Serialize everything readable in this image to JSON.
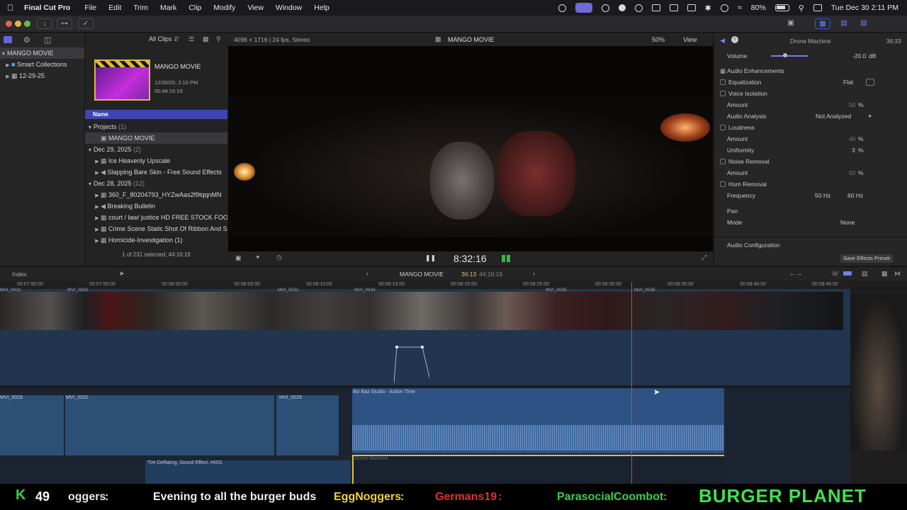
{
  "menubar": {
    "app_name": "Final Cut Pro",
    "items": [
      "File",
      "Edit",
      "Trim",
      "Mark",
      "Clip",
      "Modify",
      "View",
      "Window",
      "Help"
    ],
    "battery": "80%",
    "datetime": "Tue Dec 30  2:11 PM"
  },
  "browser": {
    "library": "MANGO MOVIE",
    "sidebar_items": [
      "Smart Collections",
      "12-29-25"
    ],
    "filter": "All Clips",
    "project_title": "MANGO MOVIE",
    "project_date": "12/30/25, 2:10 PM",
    "project_duration": "00:44:16:19",
    "column_name": "Name",
    "groups": [
      {
        "label": "Projects",
        "count": "(1)",
        "items": [
          "MANGO MOVIE"
        ]
      },
      {
        "label": "Dec 29, 2025",
        "count": "(2)",
        "items": [
          "Ice Heavenly Upscale",
          "Slapping Bare Skin - Free Sound Effects"
        ]
      },
      {
        "label": "Dec 28, 2025",
        "count": "(12)",
        "items": [
          "360_F_80204793_HYZwAas2f9tqqnMN",
          "Breaking Bulletin",
          "court / law/ justice HD FREE STOCK FOOTAGE",
          "Crime Scene Static Shot Of Ribbon And S",
          "Homicide-Investigation (1)"
        ]
      }
    ],
    "status": "1 of 231 selected, 44:16:19"
  },
  "viewer": {
    "format": "4096 × 1716 | 24 fps, Stereo",
    "title": "MANGO MOVIE",
    "zoom": "50%",
    "view_label": "View",
    "timecode": "8:32:16"
  },
  "inspector": {
    "clip_name": "Drone Machine",
    "duration": "36:33",
    "volume_label": "Volume",
    "volume_value": "-20.0",
    "volume_unit": "dB",
    "section": "Audio Enhancements",
    "rows": [
      {
        "label": "Equalization",
        "value": "Flat",
        "check": true
      },
      {
        "label": "Voice Isolation",
        "value": "",
        "check": true
      },
      {
        "label": "Amount",
        "value": "50",
        "unit": "%",
        "check": false
      },
      {
        "label": "Audio Analysis",
        "value": "Not Analyzed",
        "check": false
      },
      {
        "label": "Loudness",
        "value": "",
        "check": true
      },
      {
        "label": "Amount",
        "value": "40",
        "unit": "%",
        "check": false
      },
      {
        "label": "Uniformity",
        "value": "3",
        "unit": "%",
        "check": false
      },
      {
        "label": "Noise Removal",
        "value": "",
        "check": true
      },
      {
        "label": "Amount",
        "value": "50",
        "unit": "%",
        "check": false
      },
      {
        "label": "Hum Removal",
        "value": "",
        "check": true
      },
      {
        "label": "Frequency",
        "value": "50 Hz",
        "value2": "60 Hz",
        "check": false
      },
      {
        "label": "Pan",
        "value": "",
        "check": false
      },
      {
        "label": "Mode",
        "value": "None",
        "check": false
      }
    ],
    "audio_config": "Audio Configuration",
    "save_preset": "Save Effects Preset"
  },
  "timeline": {
    "index_label": "Index",
    "project": "MANGO MOVIE",
    "position": "36:13",
    "total": "44:16:19",
    "ruler": [
      "00:07:50:00",
      "00:07:55:00",
      "00:08:00:00",
      "00:08:05:00",
      "00:08:10:00",
      "00:08:15:00",
      "00:08:20:00",
      "00:08:25:00",
      "00:08:30:00",
      "00:08:35:00",
      "00:08:40:00",
      "00:08:45:00"
    ],
    "clip_labels": [
      "MVI_0031",
      "MVI_0031",
      "MVI_0031",
      "MVI_0034",
      "MVI_0035",
      "MVI_0036"
    ],
    "audio_labels": [
      "MVI_0029",
      "MVI_0031",
      "MVI_0029"
    ],
    "music_label": "Biz Baz Studio - Action Time",
    "sfx_label": "Tire Deflating, Sound Effect, HISS",
    "drone_label": "Drone Machine"
  },
  "ticker": {
    "count": "49",
    "messages": [
      {
        "user": "oggers",
        "text": ""
      },
      {
        "user": "",
        "text": "Evening to all the burger buds"
      },
      {
        "user": "EggNoggers",
        "text": ""
      },
      {
        "user": "Germans19",
        "text": ""
      },
      {
        "user": "ParasocialCoombot",
        "text": ""
      }
    ],
    "brand": "BURGER PLANET"
  }
}
